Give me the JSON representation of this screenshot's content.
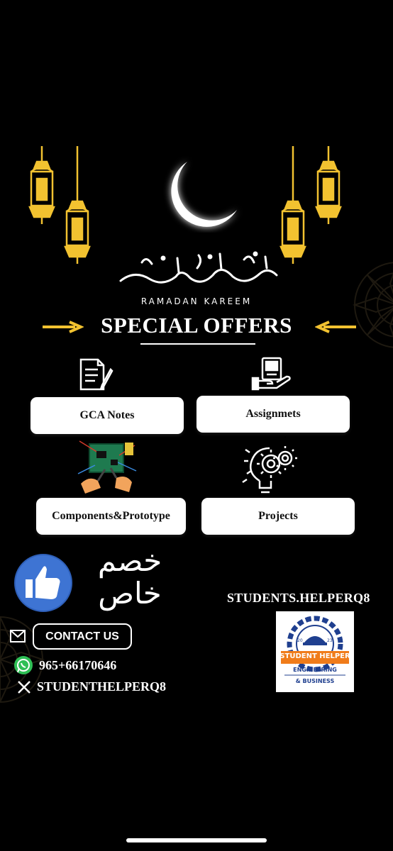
{
  "header": {
    "ramadan_subtitle": "RAMADAN KAREEM",
    "title": "SPECIAL OFFERS"
  },
  "offers": [
    {
      "label": "GCA Notes",
      "icon": "document-pen-icon"
    },
    {
      "label": "Assignmets",
      "icon": "hand-laptop-icon"
    },
    {
      "label": "Components&Prototype",
      "icon": "circuit-board-icon"
    },
    {
      "label": "Projects",
      "icon": "lightbulb-gear-icon"
    }
  ],
  "discount": {
    "arabic_text": "خصم خاص",
    "icon": "thumbs-up-icon"
  },
  "brand": {
    "handle": "STUDENTS.HELPERQ8",
    "logo": {
      "title": "STUDENT HELPER",
      "line1": "ENGINEERING",
      "line2": "& BUSINESS",
      "year_left": "20",
      "year_right": "23"
    }
  },
  "contact": {
    "button_label": "CONTACT US",
    "phone": "965+66170646",
    "x_handle": "STUDENTHELPERQ8"
  },
  "colors": {
    "background": "#000000",
    "gold": "#F2C230",
    "card": "#FFFFFF",
    "thumb_blue": "#3E74D3",
    "logo_navy": "#1F3F8F",
    "logo_orange": "#F07C1A"
  }
}
